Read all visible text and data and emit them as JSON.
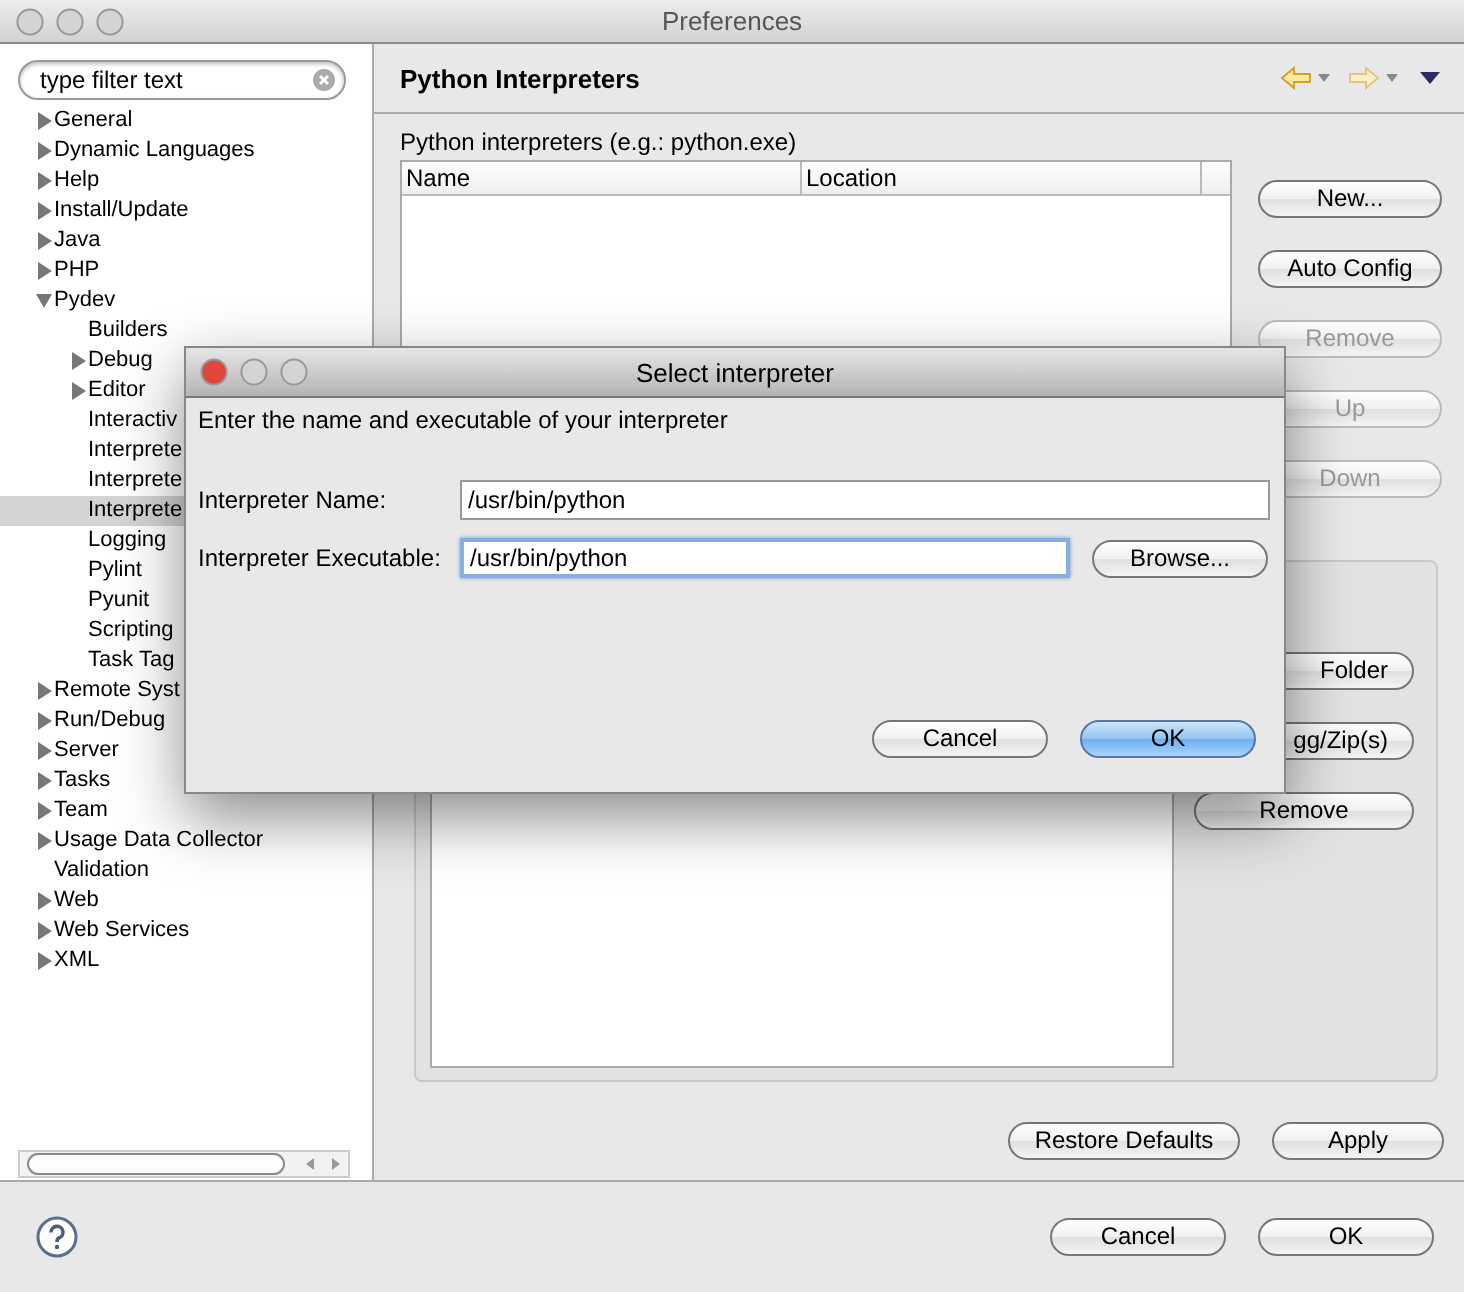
{
  "window": {
    "title": "Preferences"
  },
  "sidebar": {
    "filter": {
      "placeholder": "type filter text"
    },
    "tree": [
      {
        "label": "General",
        "expanded": false,
        "selected": false
      },
      {
        "label": "Dynamic Languages",
        "expanded": false,
        "selected": false
      },
      {
        "label": "Help",
        "expanded": false,
        "selected": false
      },
      {
        "label": "Install/Update",
        "expanded": false,
        "selected": false
      },
      {
        "label": "Java",
        "expanded": false,
        "selected": false
      },
      {
        "label": "PHP",
        "expanded": false,
        "selected": false
      },
      {
        "label": "Pydev",
        "expanded": true,
        "selected": false,
        "children": [
          {
            "label": "Builders",
            "selected": false
          },
          {
            "label": "Debug",
            "expanded": false,
            "selected": false
          },
          {
            "label": "Editor",
            "expanded": false,
            "selected": false
          },
          {
            "label": "Interactiv",
            "selected": false
          },
          {
            "label": "Interprete",
            "selected": false
          },
          {
            "label": "Interprete",
            "selected": false
          },
          {
            "label": "Interprete",
            "selected": true
          },
          {
            "label": "Logging",
            "selected": false
          },
          {
            "label": "Pylint",
            "selected": false
          },
          {
            "label": "Pyunit",
            "selected": false
          },
          {
            "label": "Scripting",
            "selected": false
          },
          {
            "label": "Task Tag",
            "selected": false
          }
        ]
      },
      {
        "label": "Remote Syst",
        "expanded": false,
        "selected": false
      },
      {
        "label": "Run/Debug",
        "expanded": false,
        "selected": false
      },
      {
        "label": "Server",
        "expanded": false,
        "selected": false
      },
      {
        "label": "Tasks",
        "expanded": false,
        "selected": false
      },
      {
        "label": "Team",
        "expanded": false,
        "selected": false
      },
      {
        "label": "Usage Data Collector",
        "expanded": false,
        "selected": false
      },
      {
        "label": "Validation",
        "selected": false
      },
      {
        "label": "Web",
        "expanded": false,
        "selected": false
      },
      {
        "label": "Web Services",
        "expanded": false,
        "selected": false
      },
      {
        "label": "XML",
        "expanded": false,
        "selected": false
      }
    ]
  },
  "page": {
    "title": "Python Interpreters",
    "table_label": "Python interpreters (e.g.: python.exe)",
    "table": {
      "columns": [
        "Name",
        "Location"
      ]
    },
    "buttons": [
      {
        "label": "New...",
        "disabled": false
      },
      {
        "label": "Auto Config",
        "disabled": false
      },
      {
        "label": "Remove",
        "disabled": true
      },
      {
        "label": "Up",
        "disabled": true
      },
      {
        "label": "Down",
        "disabled": true
      }
    ],
    "libraries": {
      "buttons": [
        {
          "label": "Folder",
          "disabled": false
        },
        {
          "label": "gg/Zip(s)",
          "disabled": false
        },
        {
          "label": "Remove",
          "disabled": false
        }
      ]
    },
    "actions": [
      "Restore Defaults",
      "Apply"
    ]
  },
  "footer": {
    "buttons": [
      "Cancel",
      "OK"
    ]
  },
  "dialog": {
    "title": "Select interpreter",
    "message": "Enter the name and executable of your interpreter",
    "fields": [
      {
        "label": "Interpreter Name:",
        "value": "/usr/bin/python",
        "focused": false
      },
      {
        "label": "Interpreter Executable:",
        "value": "/usr/bin/python",
        "focused": true,
        "button": "Browse..."
      }
    ],
    "buttons": [
      {
        "label": "Cancel",
        "default": false
      },
      {
        "label": "OK",
        "default": true
      }
    ]
  }
}
